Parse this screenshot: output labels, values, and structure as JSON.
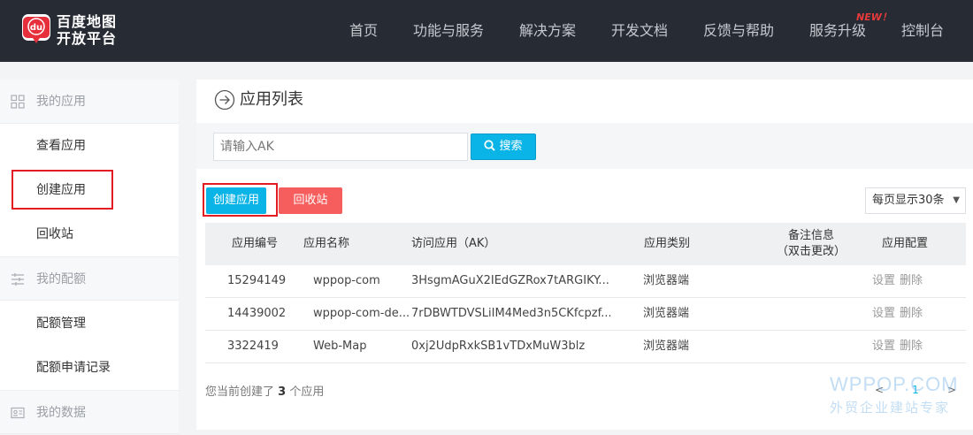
{
  "brand": {
    "badge_text": "du",
    "name_line1": "百度地图",
    "name_line2": "开放平台"
  },
  "nav": {
    "items": [
      "首页",
      "功能与服务",
      "解决方案",
      "开发文档",
      "反馈与帮助",
      "服务升级",
      "控制台"
    ],
    "new_badge": "NEW！"
  },
  "sidebar": {
    "groups": [
      {
        "label": "我的应用",
        "icon": "grid-icon"
      },
      {
        "label": "我的配额",
        "icon": "list-icon"
      },
      {
        "label": "我的数据",
        "icon": "id-card-icon"
      }
    ],
    "items": [
      "查看应用",
      "创建应用",
      "回收站",
      "配额管理",
      "配额申请记录"
    ]
  },
  "page": {
    "title": "应用列表",
    "title_icon": "arrow-circle-icon"
  },
  "search": {
    "placeholder": "请输入AK",
    "button_label": "搜索",
    "icon": "search-icon"
  },
  "actions": {
    "create_label": "创建应用",
    "recycle_label": "回收站",
    "page_size_label": "每页显示30条"
  },
  "table": {
    "headers": {
      "id": "应用编号",
      "name": "应用名称",
      "ak": "访问应用（AK）",
      "type": "应用类别",
      "note_line1": "备注信息",
      "note_line2": "（双击更改）",
      "config": "应用配置"
    },
    "rows": [
      {
        "id": "15294149",
        "name": "wppop-com",
        "ak": "3HsgmAGuX2IEdGZRox7tARGIKY...",
        "type": "浏览器端",
        "note": "",
        "settings": "设置",
        "delete": "删除"
      },
      {
        "id": "14439002",
        "name": "wppop-com-de...",
        "ak": "7rDBWTDVSLiIM4Med3n5CKfcpzf...",
        "type": "浏览器端",
        "note": "",
        "settings": "设置",
        "delete": "删除"
      },
      {
        "id": "3322419",
        "name": "Web-Map",
        "ak": "0xj2UdpRxkSB1vTDxMuW3blz",
        "type": "浏览器端",
        "note": "",
        "settings": "设置",
        "delete": "删除"
      }
    ]
  },
  "summary": {
    "prefix": "您当前创建了",
    "count": "3",
    "suffix": "个应用"
  },
  "pager": {
    "prev": "<",
    "current": "1",
    "next": ">"
  },
  "watermark": {
    "line1": "WPPOP.COM",
    "line2": "外贸企业建站专家"
  },
  "colors": {
    "topbar": "#262b34",
    "accent_blue": "#0ab4e6",
    "accent_red": "#f65d5d",
    "highlight_red": "#e31b23"
  }
}
